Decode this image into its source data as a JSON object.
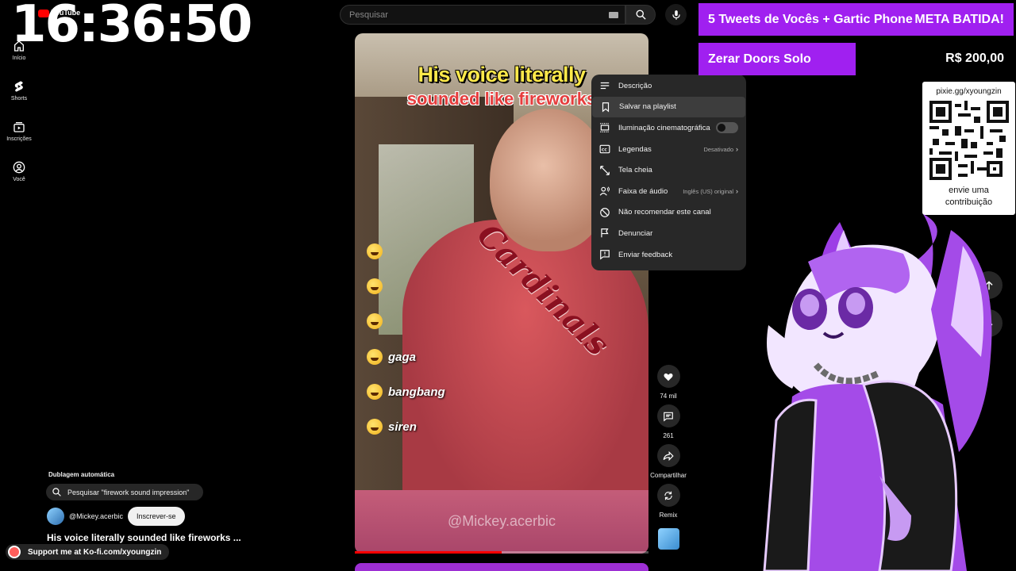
{
  "clock": "16:36:50",
  "logo": "YouTube",
  "sidebar": {
    "items": [
      {
        "label": "Início",
        "icon": "home-icon"
      },
      {
        "label": "Shorts",
        "icon": "shorts-icon"
      },
      {
        "label": "Inscrições",
        "icon": "subscriptions-icon"
      },
      {
        "label": "Você",
        "icon": "you-icon"
      }
    ]
  },
  "search": {
    "placeholder": "Pesquisar"
  },
  "video": {
    "caption_top": "His voice literally",
    "caption_bottom": "sounded like fireworks",
    "shirt_text": "Cardinals",
    "emoji_labels": [
      "",
      "",
      "",
      "gaga",
      "bangbang",
      "siren"
    ],
    "watermark": "@Mickey.acerbic",
    "progress": 0.5
  },
  "actions": {
    "like_count": "74 mil",
    "comment_count": "261",
    "share_label": "Compartilhar",
    "remix_label": "Remix"
  },
  "menu": {
    "items": [
      {
        "label": "Descrição",
        "icon": "description-icon"
      },
      {
        "label": "Salvar na playlist",
        "icon": "bookmark-icon"
      },
      {
        "label": "Iluminação cinematográfica",
        "icon": "cinematic-icon",
        "toggle": false
      },
      {
        "label": "Legendas",
        "icon": "captions-icon",
        "value": "Desativado"
      },
      {
        "label": "Tela cheia",
        "icon": "fullscreen-icon"
      },
      {
        "label": "Faixa de áudio",
        "icon": "audio-track-icon",
        "value": "Inglês (US) original"
      },
      {
        "label": "Não recomendar este canal",
        "icon": "block-icon"
      },
      {
        "label": "Denunciar",
        "icon": "flag-icon"
      },
      {
        "label": "Enviar feedback",
        "icon": "feedback-icon"
      }
    ]
  },
  "overlay": {
    "dub_label": "Dublagem automática",
    "search_chip": "Pesquisar \"firework sound impression\"",
    "channel": "@Mickey.acerbic",
    "subscribe": "Inscrever-se",
    "title": "His voice literally sounded like fireworks ..."
  },
  "stream": {
    "goal1_left": "5 Tweets de Vocês + Gartic Phone",
    "goal1_right": "META BATIDA!",
    "goal2": "Zerar Doors Solo",
    "price": "R$ 200,00",
    "kofi": "Support me at Ko-fi.com/xyoungzin",
    "pixie_url": "pixie.gg/xyoungzin",
    "pixie_cta_line1": "envie uma",
    "pixie_cta_line2": "contribuição"
  },
  "colors": {
    "accent": "#a020f0",
    "progress": "#ff0000",
    "menu_bg": "#282828"
  }
}
